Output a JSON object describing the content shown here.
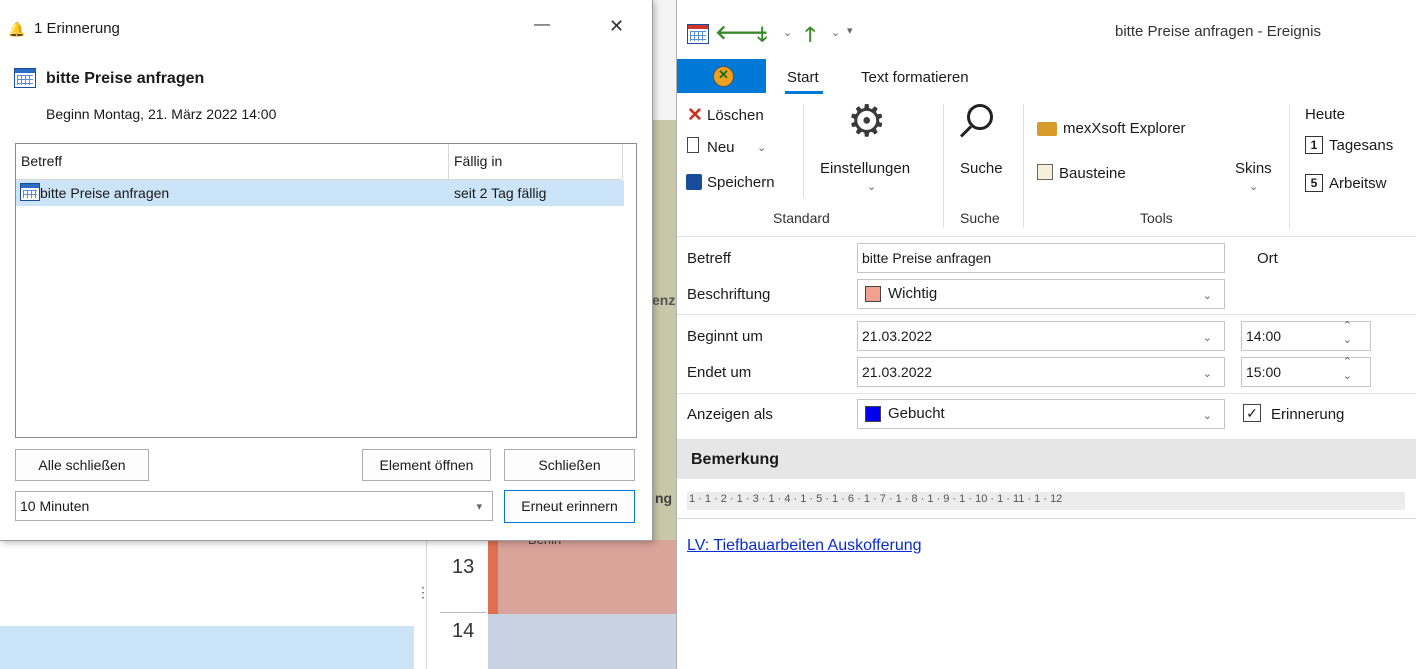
{
  "reminder": {
    "title": "1 Erinnerung",
    "minimize_glyph": "—",
    "close_glyph": "✕",
    "subject": "bitte Preise anfragen",
    "start_text": "Beginn Montag, 21. März 2022 14:00",
    "columns": [
      "Betreff",
      "Fällig in"
    ],
    "rows": [
      {
        "subject": "bitte Preise anfragen",
        "due": "seit 2 Tag fällig"
      }
    ],
    "buttons": {
      "close_all": "Alle schließen",
      "open_item": "Element öffnen",
      "close": "Schließen",
      "snooze": "Erneut erinnern"
    },
    "snooze_select": "10 Minuten"
  },
  "background": {
    "hour_13": "13",
    "hour_14": "14",
    "partial_a": "enz",
    "partial_b": "ng",
    "partial_c": "Berlin"
  },
  "event": {
    "window_title": "bitte Preise anfragen - Ereignis",
    "tabs": [
      "Start",
      "Text formatieren"
    ],
    "ribbon": {
      "delete": "Löschen",
      "new": "Neu",
      "save": "Speichern",
      "settings": "Einstellungen",
      "search": "Suche",
      "explorer": "mexXsoft Explorer",
      "blocks": "Bausteine",
      "skins": "Skins",
      "today": "Heute",
      "day_view": "Tagesans",
      "work_week": "Arbeitsw",
      "groups": [
        "Standard",
        "Suche",
        "Tools"
      ]
    },
    "form": {
      "subject_label": "Betreff",
      "subject_value": "bitte Preise anfragen",
      "location_label": "Ort",
      "label_label": "Beschriftung",
      "label_value": "Wichtig",
      "label_color": "#f4a090",
      "start_label": "Beginnt um",
      "start_date": "21.03.2022",
      "start_time": "14:00",
      "end_label": "Endet um",
      "end_date": "21.03.2022",
      "end_time": "15:00",
      "show_as_label": "Anzeigen als",
      "show_as_value": "Gebucht",
      "show_as_color": "#0000ee",
      "reminder_label": "Erinnerung",
      "reminder_checked": true
    },
    "notes": {
      "header": "Bemerkung",
      "ruler": "1 · 1 · 2 · 1 · 3 · 1 · 4 · 1 · 5 · 1 · 6 · 1 · 7 · 1 · 8 · 1 · 9 · 1 · 10 · 1 · 11 · 1 · 12",
      "link_text": "LV: Tiefbauarbeiten Auskofferung"
    }
  }
}
